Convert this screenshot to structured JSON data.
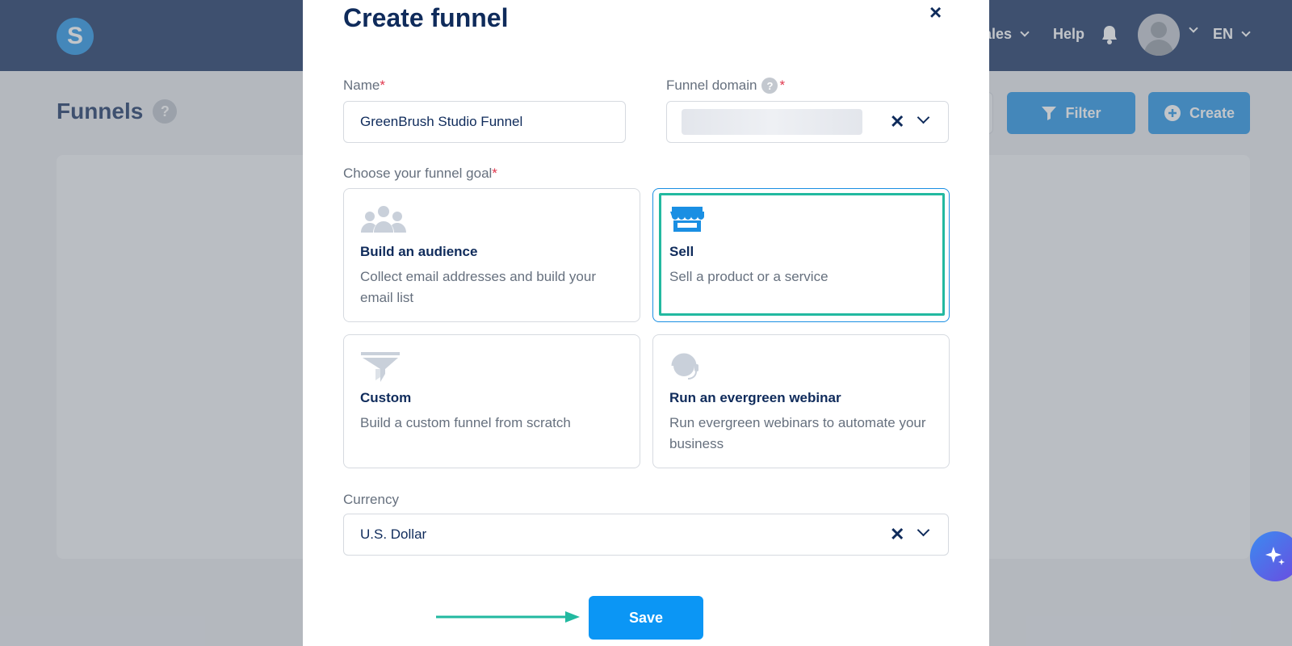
{
  "header": {
    "logo_letter": "S",
    "nav_sales": "ales",
    "nav_help": "Help",
    "nav_lang": "EN"
  },
  "background_page": {
    "title": "Funnels",
    "help_badge": "?",
    "filter_label": "Filter",
    "create_label": "Create"
  },
  "modal": {
    "title": "Create funnel",
    "close": "×",
    "name": {
      "label": "Name",
      "required": "*",
      "value": "GreenBrush Studio Funnel"
    },
    "domain": {
      "label": "Funnel domain",
      "help": "?",
      "required": "*",
      "clear": "✕"
    },
    "goal": {
      "label": "Choose your funnel goal",
      "required": "*",
      "options": [
        {
          "title": "Build an audience",
          "desc": "Collect email addresses and build your email list",
          "icon": "audience-icon",
          "selected": false
        },
        {
          "title": "Sell",
          "desc": "Sell a product or a service",
          "icon": "store-icon",
          "selected": true
        },
        {
          "title": "Custom",
          "desc": "Build a custom funnel from scratch",
          "icon": "funnel-icon",
          "selected": false
        },
        {
          "title": "Run an evergreen webinar",
          "desc": "Run evergreen webinars to automate your business",
          "icon": "webinar-icon",
          "selected": false
        }
      ]
    },
    "currency": {
      "label": "Currency",
      "value": "U.S. Dollar",
      "clear": "✕"
    },
    "save_label": "Save"
  },
  "colors": {
    "navy": "#0f2b5b",
    "primary": "#1a8fe3",
    "highlight": "#22b9a0"
  }
}
